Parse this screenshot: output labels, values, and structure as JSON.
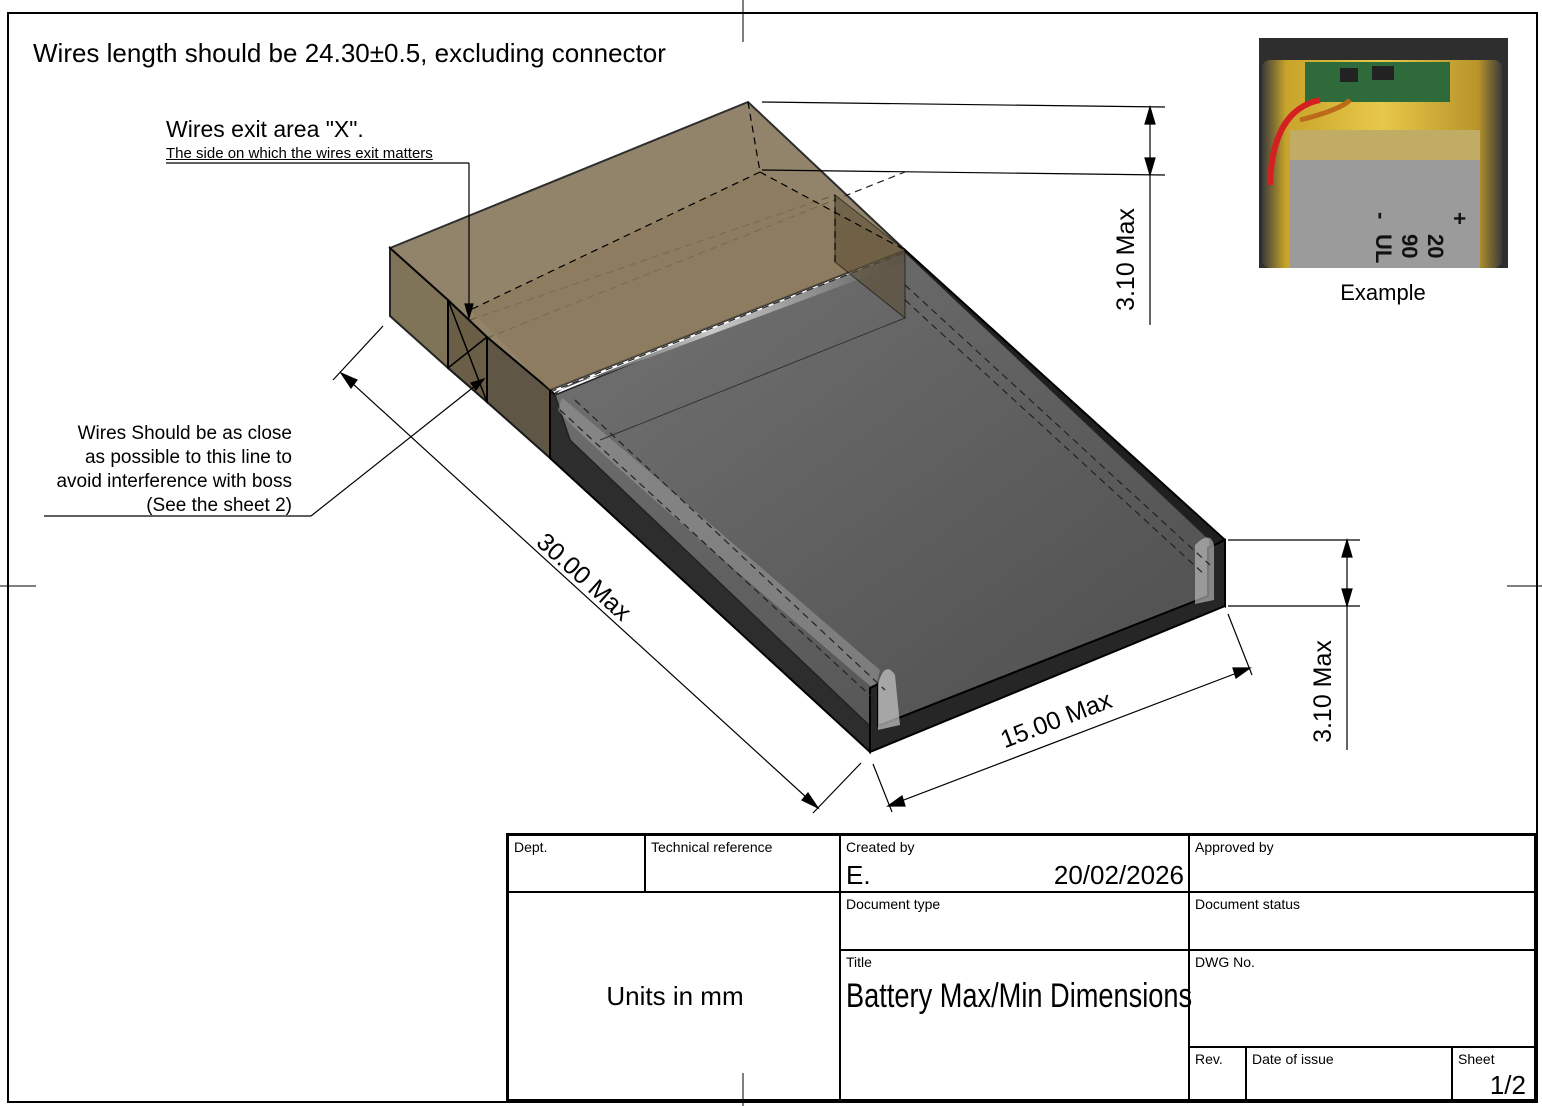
{
  "notes": {
    "wire_length": "Wires length should be 24.30±0.5, excluding connector",
    "exit_area_title": "Wires exit area \"X\".",
    "exit_area_sub": "The side on which the wires exit matters",
    "wires_close_lines": [
      "Wires Should be as close",
      "as possible to this line to",
      "avoid interference with boss",
      "(See the sheet 2)"
    ]
  },
  "example": {
    "caption": "Example",
    "battery_marks": [
      "+",
      "-",
      "UL",
      "90",
      "20"
    ]
  },
  "dimensions": {
    "height_top": "3.10 Max",
    "length": "30.00 Max",
    "width": "15.00 Max",
    "height_right": "3.10 Max"
  },
  "title_block": {
    "dept_label": "Dept.",
    "tech_ref_label": "Technical reference",
    "created_by_label": "Created by",
    "created_by": "E.",
    "created_date": "20/02/2026",
    "approved_by_label": "Approved by",
    "units": "Units in mm",
    "doc_type_label": "Document type",
    "doc_status_label": "Document status",
    "title_label": "Title",
    "title": "Battery Max/Min Dimensions",
    "dwg_no_label": "DWG No.",
    "rev_label": "Rev.",
    "date_of_issue_label": "Date of issue",
    "sheet_label": "Sheet",
    "sheet": "1/2"
  },
  "colors": {
    "envelope_fill": "#6b5c3c",
    "battery_body": "#5f5f5f",
    "battery_edge": "#2b2b2b",
    "line": "#000000"
  }
}
